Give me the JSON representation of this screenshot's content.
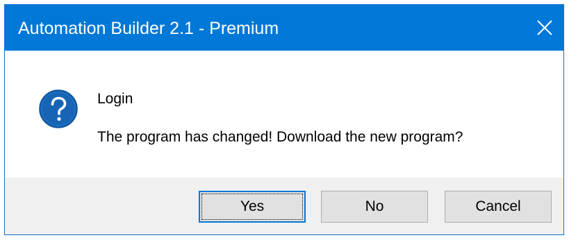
{
  "window": {
    "title": "Automation Builder 2.1 - Premium",
    "close_icon": "close-icon"
  },
  "message": {
    "icon": "question-icon",
    "title": "Login",
    "body": "The program has changed! Download the new program?"
  },
  "buttons": {
    "yes_label": "Yes",
    "no_label": "No",
    "cancel_label": "Cancel",
    "default": "Yes"
  },
  "colors": {
    "titlebar": "#0078d7",
    "icon": "#1764b5",
    "footer": "#f0f0f0",
    "button": "#e1e1e1"
  }
}
